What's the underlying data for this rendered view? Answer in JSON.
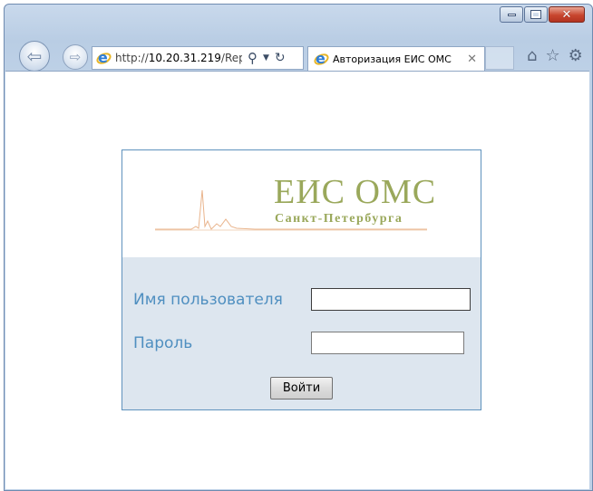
{
  "browser": {
    "url_prefix": "http://",
    "url_host": "10.20.31.219",
    "url_rest": "/Rep",
    "tab_title": "Авторизация ЕИС ОМС",
    "icons": [
      "back-icon",
      "forward-icon",
      "search-icon",
      "dropdown-icon",
      "refresh-icon",
      "tab-close-icon",
      "home-icon",
      "favorites-icon",
      "tools-gear-icon"
    ]
  },
  "window_controls": {
    "minimize": "minimize-icon",
    "maximize": "maximize-icon",
    "close": "close-icon"
  },
  "logo": {
    "title": "ЕИС ОМС",
    "subtitle": "Санкт-Петербурга",
    "color": "#9aa85b"
  },
  "login_form": {
    "username_label": "Имя пользователя",
    "username_value": "",
    "password_label": "Пароль",
    "password_value": "",
    "submit_label": "Войти",
    "label_color": "#4f8fc0",
    "panel_background": "#dde6ef",
    "panel_border": "#5f92bd"
  }
}
